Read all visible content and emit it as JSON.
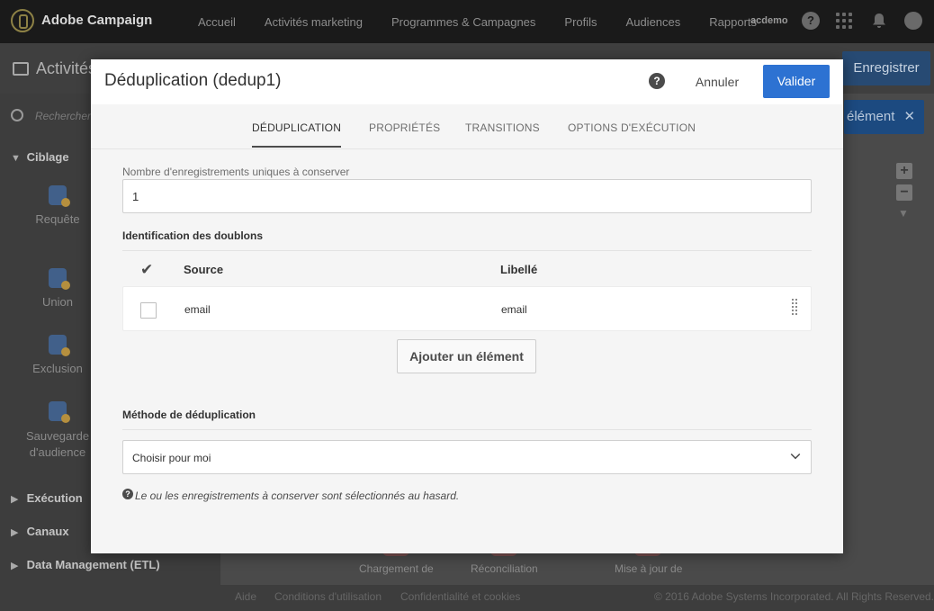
{
  "topbar": {
    "brand": "Adobe Campaign",
    "nav": [
      "Accueil",
      "Activités marketing",
      "Programmes & Campagnes",
      "Profils",
      "Audiences",
      "Rapports"
    ],
    "user": "acdemo",
    "help_glyph": "?"
  },
  "page": {
    "title": "Activités",
    "save_label": "Enregistrer",
    "element_label": "élément",
    "close_glyph": "✕",
    "search_placeholder": "Rechercher...",
    "sections": {
      "ciblage": "Ciblage",
      "execution": "Exécution",
      "canaux": "Canaux",
      "etl": "Data Management (ETL)"
    },
    "activities": [
      "Requête",
      "Union",
      "Exclusion",
      "Sauvegarde d'audience"
    ],
    "canvas_nodes": [
      "Chargement de",
      "Réconciliation",
      "Mise à jour de"
    ],
    "footer": {
      "aide": "Aide",
      "conditions": "Conditions d'utilisation",
      "confidentialite": "Confidentialité et cookies",
      "copyright": "© 2016 Adobe Systems Incorporated. All Rights Reserved."
    }
  },
  "modal": {
    "title": "Déduplication (dedup1)",
    "help_glyph": "?",
    "cancel_label": "Annuler",
    "ok_label": "Valider",
    "tabs": [
      "DÉDUPLICATION",
      "PROPRIÉTÉS",
      "TRANSITIONS",
      "OPTIONS D'EXÉCUTION"
    ],
    "active_tab": "DÉDUPLICATION",
    "unique_count": {
      "label": "Nombre d'enregistrements uniques à conserver",
      "value": "1"
    },
    "duplicates": {
      "heading": "Identification des doublons",
      "columns": {
        "check": "✔",
        "source": "Source",
        "label": "Libellé"
      },
      "rows": [
        {
          "source": "email",
          "label": "email",
          "checked": false
        }
      ],
      "add_label": "Ajouter un élément"
    },
    "method": {
      "heading": "Méthode de déduplication",
      "selected": "Choisir pour moi",
      "note_glyph": "?",
      "note": "Le ou les enregistrements à conserver sont sélectionnés au hasard."
    }
  },
  "colors": {
    "primary": "#2d72d2",
    "topbar": "#1a1a1a",
    "modal_bg": "#f5f5f5"
  }
}
